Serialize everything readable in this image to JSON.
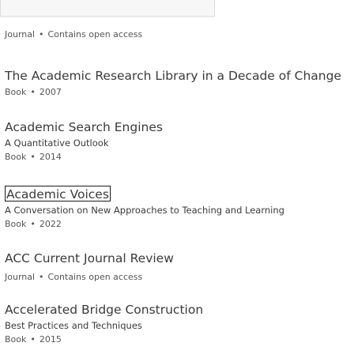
{
  "results": [
    {
      "meta_type": "Journal",
      "meta_extra": "Contains open access"
    },
    {
      "title": "The Academic Research Library in a Decade of Change",
      "meta_type": "Book",
      "meta_extra": "2007"
    },
    {
      "title": "Academic Search Engines",
      "subtitle": "A Quantitative Outlook",
      "meta_type": "Book",
      "meta_extra": "2014"
    },
    {
      "title": "Academic Voices",
      "subtitle": "A Conversation on New Approaches to Teaching and Learning",
      "meta_type": "Book",
      "meta_extra": "2022"
    },
    {
      "title": "ACC Current Journal Review",
      "meta_type": "Journal",
      "meta_extra": "Contains open access"
    },
    {
      "title": "Accelerated Bridge Construction",
      "subtitle": "Best Practices and Techniques",
      "meta_type": "Book",
      "meta_extra": "2015"
    }
  ],
  "separator": "•"
}
